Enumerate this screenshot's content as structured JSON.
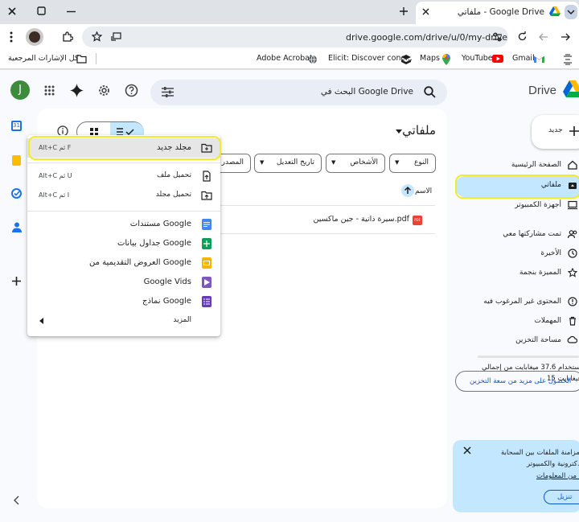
{
  "browser": {
    "tab_title": "ملفاتي - Google Drive",
    "url": "drive.google.com/drive/u/0/my-drive",
    "bookmarks": [
      "Gmail",
      "YouTube",
      "Maps",
      "Elicit: Discover conc...",
      "Adobe Acrobat"
    ],
    "all_bookmarks_label": "كل الإشارات المرجعية"
  },
  "drive": {
    "brand": "Drive",
    "search_placeholder": "البحث في Google Drive",
    "avatar_letter": "J",
    "new_button": "جديد",
    "page_title": "ملفاتي",
    "filters": [
      "النوع",
      "الأشخاص",
      "تاريخ التعديل",
      "المصدر"
    ],
    "column_name": "الاسم",
    "file_name": "سيرة ذاتية - جين ماكسين.pdf",
    "file_badge": "PDF",
    "nav": [
      "الصفحة الرئيسية",
      "ملفاتي",
      "أجهزة الكمبيوتر",
      "تمت مشاركتها معي",
      "الأخيرة",
      "المميزة بنجمة",
      "المحتوى غير المرغوب فيه",
      "المهملات",
      "مساحة التخزين"
    ],
    "storage_line1": "تم استخدام 37.6 ميغابايت من إجمالي",
    "storage_line2": "15 غيغابايت",
    "storage_button": "الحصول على مزيد من سعة التخزين",
    "promo_line1": "ك مزامنة الملفات بين السحابة",
    "promo_line2": "كترونية والكمبيوتر.",
    "promo_link": "د من المعلومات",
    "promo_button": "تنزيل"
  },
  "menu": {
    "items": [
      {
        "label": "مجلد جديد",
        "shortcut": "Alt+C ثم F"
      },
      {
        "label": "تحميل ملف",
        "shortcut": "Alt+C ثم U"
      },
      {
        "label": "تحميل مجلد",
        "shortcut": "Alt+C ثم I"
      },
      {
        "label": "مستندات Google",
        "shortcut": ""
      },
      {
        "label": "جداول بيانات Google",
        "shortcut": ""
      },
      {
        "label": "العروض التقديمية من Google",
        "shortcut": ""
      },
      {
        "label": "Google Vids",
        "shortcut": ""
      },
      {
        "label": "نماذج Google",
        "shortcut": ""
      },
      {
        "label": "المزيد",
        "shortcut": ""
      }
    ]
  },
  "colors": {
    "accent_blue": "#0b57d0",
    "highlight_yellow": "#f3ea2a",
    "selected_nav": "#c2e7ff",
    "docs_blue": "#4285f4",
    "sheets_green": "#0f9d58",
    "slides_yellow": "#f4b400",
    "vids_purple": "#7e57c2",
    "forms_purple": "#673ab7",
    "pdf_red": "#ea4335"
  }
}
